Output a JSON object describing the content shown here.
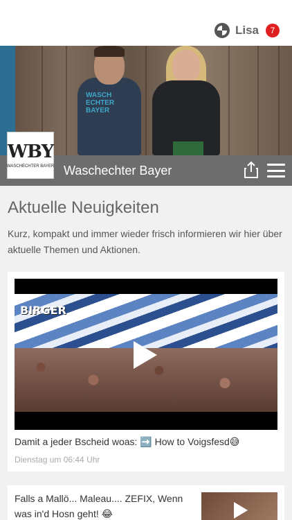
{
  "header": {
    "user_name": "Lisa",
    "notification_count": "7",
    "user_icon": "user-status-icon"
  },
  "brand": {
    "logo_mark": "WBY",
    "logo_sub": "WASCHECHTER BAYER",
    "site_title": "Waschechter Bayer",
    "hero_shirt_text": "WASCH ECHTER BAYER"
  },
  "toolbar": {
    "share_icon": "share-icon",
    "menu_icon": "hamburger-menu-icon"
  },
  "news": {
    "title": "Aktuelle Neuigkeiten",
    "intro": "Kurz, kompakt und immer wieder frisch informieren wir hier über aktuelle Themen und Aktionen.",
    "posts": [
      {
        "video_label": "BIRGER",
        "text": "Damit a jeder Bscheid woas: ➡️ How to Voigsfesd😅",
        "time": "Dienstag um 06:44 Uhr"
      },
      {
        "text": "Falls a Mallö... Maleau.... ZEFIX, Wenn was in'd Hosn geht! 😂"
      }
    ]
  },
  "colors": {
    "titlebar": "#6d6d6d",
    "badge": "#e02020",
    "background": "#f1f1f1"
  }
}
